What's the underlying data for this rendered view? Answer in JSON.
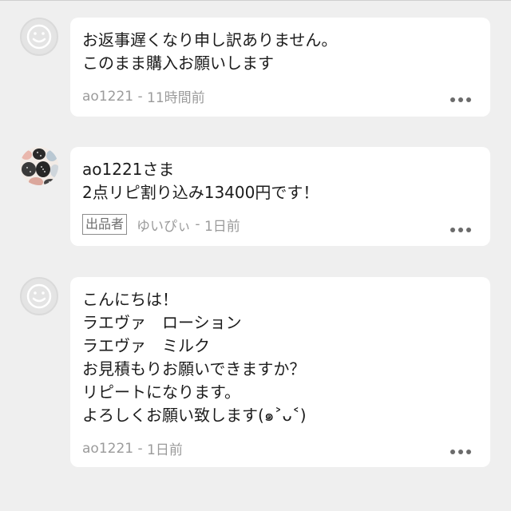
{
  "comments": [
    {
      "avatar": "default-avatar",
      "message": "お返事遅くなり申し訳ありません。\nこのまま購入お願いします",
      "badge": "",
      "username": "ao1221",
      "separator": " - ",
      "time": "11時間前",
      "menu_icon": "more-horizontal-icon"
    },
    {
      "avatar": "seller-photo-avatar",
      "message": "ao1221さま\n2点リピ割り込み13400円です！",
      "badge": "出品者",
      "username": "ゆいぴぃ",
      "separator": " - ",
      "time": "1日前",
      "menu_icon": "more-horizontal-icon"
    },
    {
      "avatar": "default-avatar",
      "message": "こんにちは！\nラエヴァ　ローション\nラエヴァ　ミルク\nお見積もりお願いできますか？\nリピートになります。\nよろしくお願い致します(๑˃ᴗ˂)",
      "badge": "",
      "username": "ao1221",
      "separator": " - ",
      "time": "1日前",
      "menu_icon": "more-horizontal-icon"
    }
  ],
  "colors": {
    "background": "#efefef",
    "bubble": "#ffffff",
    "text": "#1c1c1c",
    "meta": "#9b9b9b",
    "dots": "#6b6b6b"
  }
}
